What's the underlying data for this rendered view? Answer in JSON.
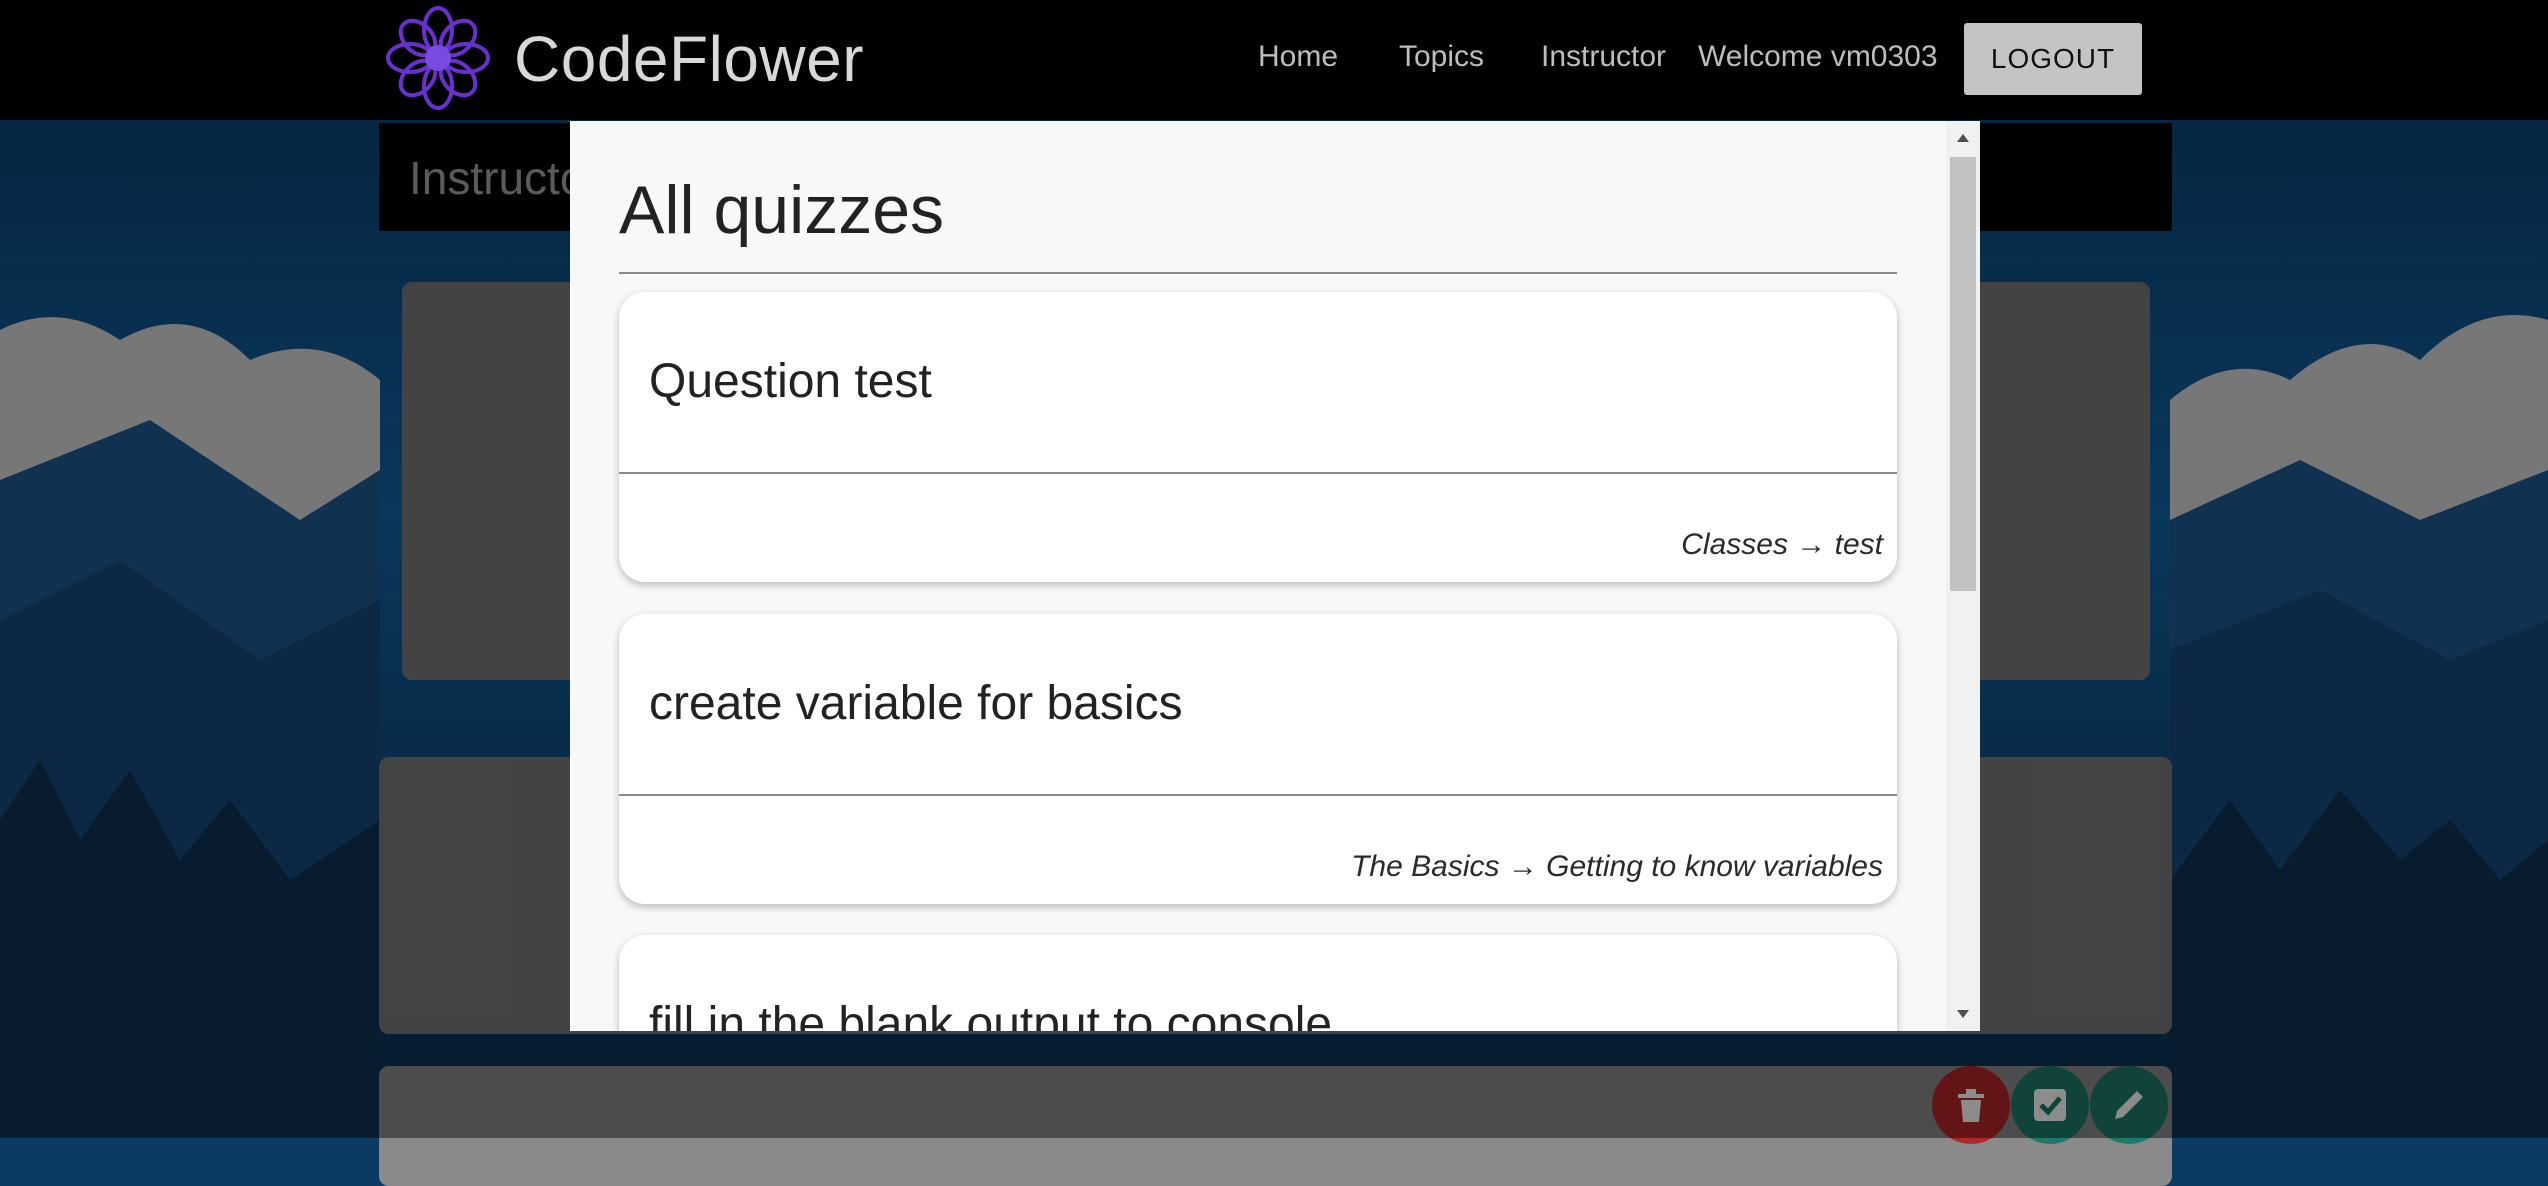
{
  "navbar": {
    "brand": "CodeFlower",
    "links": [
      "Home",
      "Topics",
      "Instructor"
    ],
    "welcome": "Welcome vm0303",
    "logout_label": "LOGOUT"
  },
  "page": {
    "banner_title": "Instructo",
    "fab_icons": [
      "trash-icon",
      "check-square-icon",
      "pencil-icon"
    ]
  },
  "modal": {
    "title": "All quizzes",
    "quizzes": [
      {
        "name": "Question test",
        "path": "Classes → test"
      },
      {
        "name": "create variable for basics",
        "path": "The Basics → Getting to know variables"
      },
      {
        "name": "fill in the blank output to console",
        "path": ""
      }
    ]
  },
  "colors": {
    "navbar": "#000000",
    "logo_purple": "#6a2fd0",
    "fab_delete": "#b3262a",
    "fab_check": "#1e7a6a",
    "fab_edit": "#1e7a6a"
  }
}
